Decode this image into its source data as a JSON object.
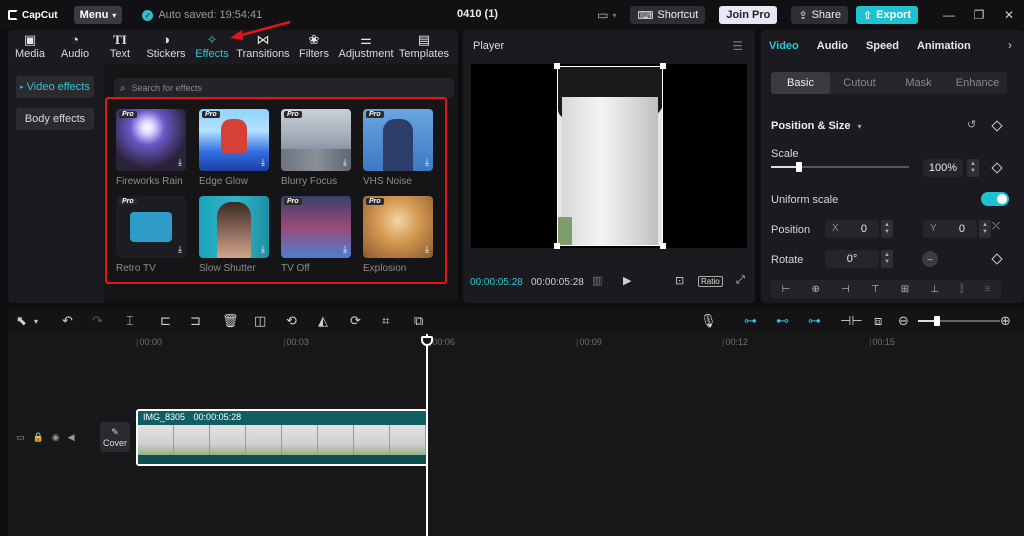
{
  "app": {
    "name": "CapCut",
    "menu_label": "Menu",
    "autosave_text": "Auto saved: 19:54:41",
    "project_title": "0410 (1)",
    "shortcut_label": "Shortcut",
    "join_pro_label": "Join Pro",
    "share_label": "Share",
    "export_label": "Export"
  },
  "media_tabs": [
    {
      "label": "Media",
      "icon": "media-icon"
    },
    {
      "label": "Audio",
      "icon": "audio-icon"
    },
    {
      "label": "Text",
      "icon": "text-icon"
    },
    {
      "label": "Stickers",
      "icon": "stickers-icon"
    },
    {
      "label": "Effects",
      "icon": "effects-icon",
      "active": true
    },
    {
      "label": "Transitions",
      "icon": "transitions-icon"
    },
    {
      "label": "Filters",
      "icon": "filters-icon"
    },
    {
      "label": "Adjustment",
      "icon": "adjustment-icon"
    },
    {
      "label": "Templates",
      "icon": "templates-icon"
    }
  ],
  "effects_sidebar": [
    {
      "label": "Video effects",
      "active": true
    },
    {
      "label": "Body effects",
      "active": false
    }
  ],
  "search": {
    "placeholder": "Search for effects"
  },
  "pro_badge": "Pro",
  "effects": [
    {
      "name": "Fireworks Rain",
      "pro": true
    },
    {
      "name": "Edge Glow",
      "pro": true
    },
    {
      "name": "Blurry Focus",
      "pro": true
    },
    {
      "name": "VHS Noise",
      "pro": true
    },
    {
      "name": "Retro TV",
      "pro": true
    },
    {
      "name": "Slow Shutter",
      "pro": false
    },
    {
      "name": "TV Off",
      "pro": true
    },
    {
      "name": "Explosion",
      "pro": true
    }
  ],
  "player": {
    "title": "Player",
    "current_time": "00:00:05:28",
    "total_time": "00:00:05:28",
    "ratio_label": "Ratio"
  },
  "properties": {
    "tabs": [
      "Video",
      "Audio",
      "Speed",
      "Animation"
    ],
    "active_tab": "Video",
    "subtabs": [
      "Basic",
      "Cutout",
      "Mask",
      "Enhance"
    ],
    "section_title": "Position & Size",
    "scale_label": "Scale",
    "scale_value": "100%",
    "scale_fraction": 0.2,
    "uniform_scale_label": "Uniform scale",
    "uniform_scale_on": true,
    "position_label": "Position",
    "pos_x_label": "X",
    "pos_x": "0",
    "pos_y_label": "Y",
    "pos_y": "0",
    "rotate_label": "Rotate",
    "rotate_value": "0°"
  },
  "timeline": {
    "ticks": [
      "00:00",
      "00:03",
      "00:06",
      "00:09",
      "00:12",
      "00:15"
    ],
    "clip_name": "IMG_8305",
    "clip_duration": "00:00:05:28",
    "cover_label": "Cover"
  },
  "colors": {
    "accent": "#1ec1d0",
    "highlight_box": "#e3151b"
  }
}
